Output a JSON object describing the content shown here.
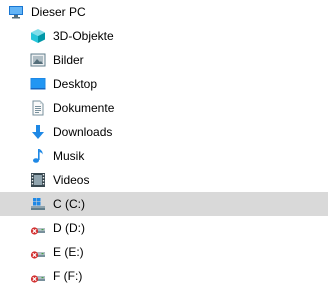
{
  "tree": {
    "root": {
      "label": "Dieser PC",
      "icon": "computer-icon"
    },
    "items": [
      {
        "label": "3D-Objekte",
        "icon": "3d-objects-icon"
      },
      {
        "label": "Bilder",
        "icon": "pictures-icon"
      },
      {
        "label": "Desktop",
        "icon": "desktop-icon"
      },
      {
        "label": "Dokumente",
        "icon": "documents-icon"
      },
      {
        "label": "Downloads",
        "icon": "downloads-icon"
      },
      {
        "label": "Musik",
        "icon": "music-icon"
      },
      {
        "label": "Videos",
        "icon": "videos-icon"
      },
      {
        "label": "C (C:)",
        "icon": "windows-drive-icon",
        "selected": true
      },
      {
        "label": "D (D:)",
        "icon": "disconnected-network-drive-icon"
      },
      {
        "label": "E (E:)",
        "icon": "disconnected-network-drive-icon"
      },
      {
        "label": "F (F:)",
        "icon": "disconnected-network-drive-icon"
      }
    ]
  },
  "colors": {
    "selection": "#d9d9d9",
    "folder_blue": "#1e88e5",
    "error_red": "#d32f2f"
  }
}
